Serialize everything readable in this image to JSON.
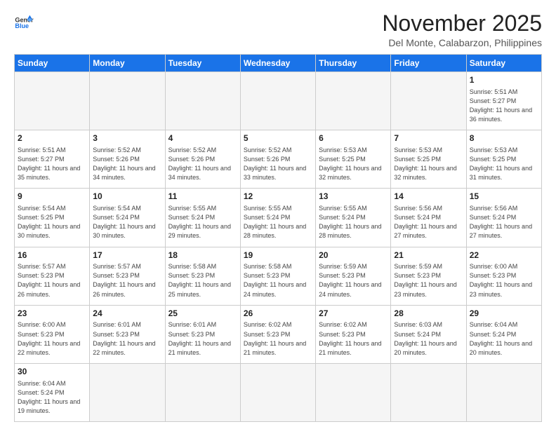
{
  "header": {
    "logo_general": "General",
    "logo_blue": "Blue",
    "title": "November 2025",
    "subtitle": "Del Monte, Calabarzon, Philippines"
  },
  "weekdays": [
    "Sunday",
    "Monday",
    "Tuesday",
    "Wednesday",
    "Thursday",
    "Friday",
    "Saturday"
  ],
  "weeks": [
    [
      {
        "date": "",
        "info": ""
      },
      {
        "date": "",
        "info": ""
      },
      {
        "date": "",
        "info": ""
      },
      {
        "date": "",
        "info": ""
      },
      {
        "date": "",
        "info": ""
      },
      {
        "date": "",
        "info": ""
      },
      {
        "date": "1",
        "info": "Sunrise: 5:51 AM\nSunset: 5:27 PM\nDaylight: 11 hours\nand 36 minutes."
      }
    ],
    [
      {
        "date": "2",
        "info": "Sunrise: 5:51 AM\nSunset: 5:27 PM\nDaylight: 11 hours\nand 35 minutes."
      },
      {
        "date": "3",
        "info": "Sunrise: 5:52 AM\nSunset: 5:26 PM\nDaylight: 11 hours\nand 34 minutes."
      },
      {
        "date": "4",
        "info": "Sunrise: 5:52 AM\nSunset: 5:26 PM\nDaylight: 11 hours\nand 34 minutes."
      },
      {
        "date": "5",
        "info": "Sunrise: 5:52 AM\nSunset: 5:26 PM\nDaylight: 11 hours\nand 33 minutes."
      },
      {
        "date": "6",
        "info": "Sunrise: 5:53 AM\nSunset: 5:25 PM\nDaylight: 11 hours\nand 32 minutes."
      },
      {
        "date": "7",
        "info": "Sunrise: 5:53 AM\nSunset: 5:25 PM\nDaylight: 11 hours\nand 32 minutes."
      },
      {
        "date": "8",
        "info": "Sunrise: 5:53 AM\nSunset: 5:25 PM\nDaylight: 11 hours\nand 31 minutes."
      }
    ],
    [
      {
        "date": "9",
        "info": "Sunrise: 5:54 AM\nSunset: 5:25 PM\nDaylight: 11 hours\nand 30 minutes."
      },
      {
        "date": "10",
        "info": "Sunrise: 5:54 AM\nSunset: 5:24 PM\nDaylight: 11 hours\nand 30 minutes."
      },
      {
        "date": "11",
        "info": "Sunrise: 5:55 AM\nSunset: 5:24 PM\nDaylight: 11 hours\nand 29 minutes."
      },
      {
        "date": "12",
        "info": "Sunrise: 5:55 AM\nSunset: 5:24 PM\nDaylight: 11 hours\nand 28 minutes."
      },
      {
        "date": "13",
        "info": "Sunrise: 5:55 AM\nSunset: 5:24 PM\nDaylight: 11 hours\nand 28 minutes."
      },
      {
        "date": "14",
        "info": "Sunrise: 5:56 AM\nSunset: 5:24 PM\nDaylight: 11 hours\nand 27 minutes."
      },
      {
        "date": "15",
        "info": "Sunrise: 5:56 AM\nSunset: 5:24 PM\nDaylight: 11 hours\nand 27 minutes."
      }
    ],
    [
      {
        "date": "16",
        "info": "Sunrise: 5:57 AM\nSunset: 5:23 PM\nDaylight: 11 hours\nand 26 minutes."
      },
      {
        "date": "17",
        "info": "Sunrise: 5:57 AM\nSunset: 5:23 PM\nDaylight: 11 hours\nand 26 minutes."
      },
      {
        "date": "18",
        "info": "Sunrise: 5:58 AM\nSunset: 5:23 PM\nDaylight: 11 hours\nand 25 minutes."
      },
      {
        "date": "19",
        "info": "Sunrise: 5:58 AM\nSunset: 5:23 PM\nDaylight: 11 hours\nand 24 minutes."
      },
      {
        "date": "20",
        "info": "Sunrise: 5:59 AM\nSunset: 5:23 PM\nDaylight: 11 hours\nand 24 minutes."
      },
      {
        "date": "21",
        "info": "Sunrise: 5:59 AM\nSunset: 5:23 PM\nDaylight: 11 hours\nand 23 minutes."
      },
      {
        "date": "22",
        "info": "Sunrise: 6:00 AM\nSunset: 5:23 PM\nDaylight: 11 hours\nand 23 minutes."
      }
    ],
    [
      {
        "date": "23",
        "info": "Sunrise: 6:00 AM\nSunset: 5:23 PM\nDaylight: 11 hours\nand 22 minutes."
      },
      {
        "date": "24",
        "info": "Sunrise: 6:01 AM\nSunset: 5:23 PM\nDaylight: 11 hours\nand 22 minutes."
      },
      {
        "date": "25",
        "info": "Sunrise: 6:01 AM\nSunset: 5:23 PM\nDaylight: 11 hours\nand 21 minutes."
      },
      {
        "date": "26",
        "info": "Sunrise: 6:02 AM\nSunset: 5:23 PM\nDaylight: 11 hours\nand 21 minutes."
      },
      {
        "date": "27",
        "info": "Sunrise: 6:02 AM\nSunset: 5:23 PM\nDaylight: 11 hours\nand 21 minutes."
      },
      {
        "date": "28",
        "info": "Sunrise: 6:03 AM\nSunset: 5:24 PM\nDaylight: 11 hours\nand 20 minutes."
      },
      {
        "date": "29",
        "info": "Sunrise: 6:04 AM\nSunset: 5:24 PM\nDaylight: 11 hours\nand 20 minutes."
      }
    ],
    [
      {
        "date": "30",
        "info": "Sunrise: 6:04 AM\nSunset: 5:24 PM\nDaylight: 11 hours\nand 19 minutes."
      },
      {
        "date": "",
        "info": ""
      },
      {
        "date": "",
        "info": ""
      },
      {
        "date": "",
        "info": ""
      },
      {
        "date": "",
        "info": ""
      },
      {
        "date": "",
        "info": ""
      },
      {
        "date": "",
        "info": ""
      }
    ]
  ]
}
